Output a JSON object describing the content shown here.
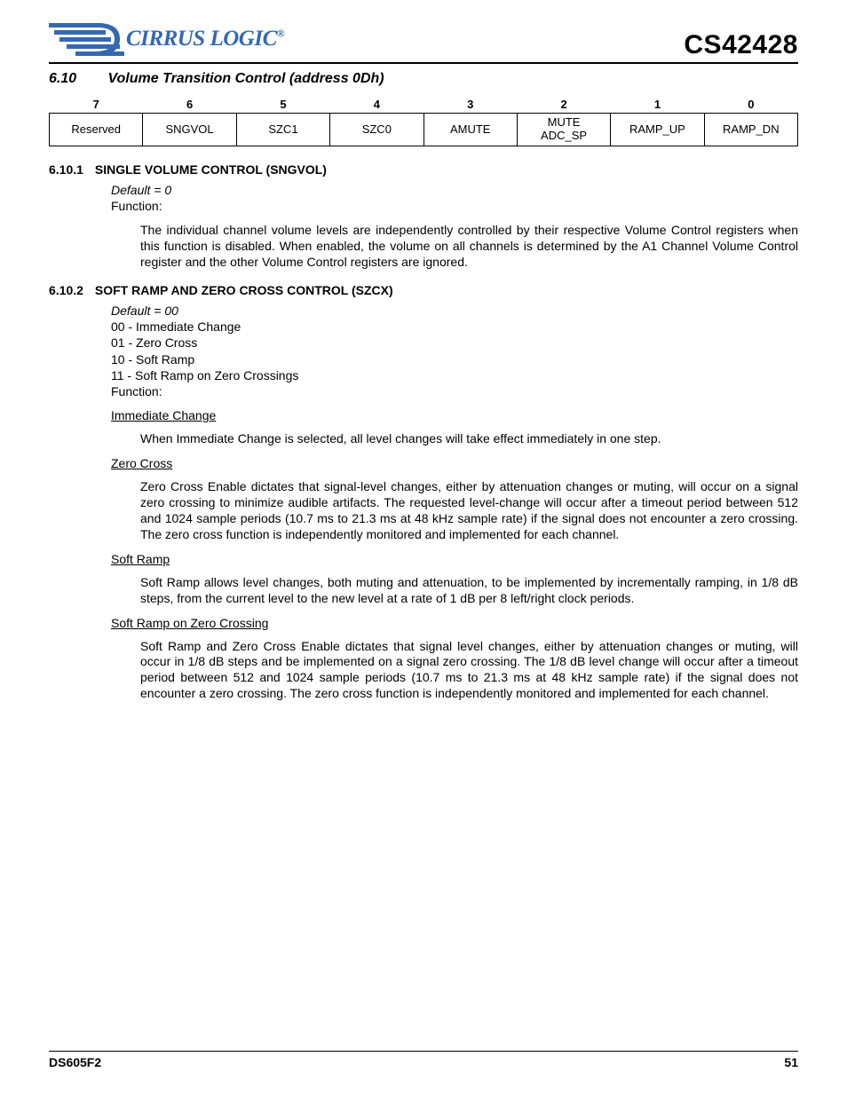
{
  "header": {
    "logo_text": "CIRRUS LOGIC",
    "part_number": "CS42428"
  },
  "section": {
    "number": "6.10",
    "title": "Volume Transition Control (address 0Dh)"
  },
  "bit_table": {
    "headers": [
      "7",
      "6",
      "5",
      "4",
      "3",
      "2",
      "1",
      "0"
    ],
    "cells": [
      "Reserved",
      "SNGVOL",
      "SZC1",
      "SZC0",
      "AMUTE",
      "MUTE ADC_SP",
      "RAMP_UP",
      "RAMP_DN"
    ]
  },
  "sub1": {
    "number": "6.10.1",
    "title": "SINGLE VOLUME CONTROL (SNGVOL)",
    "default_line": "Default = 0",
    "function_label": "Function:",
    "para": "The individual channel volume levels are independently controlled by their respective Volume Control registers when this function is disabled. When enabled, the volume on all channels is determined by the A1 Channel Volume Control register and the other Volume Control registers are ignored."
  },
  "sub2": {
    "number": "6.10.2",
    "title": "SOFT RAMP AND ZERO CROSS CONTROL (SZCX)",
    "default_line": "Default = 00",
    "opt0": "00 - Immediate Change",
    "opt1": "01 - Zero Cross",
    "opt2": "10 - Soft Ramp",
    "opt3": "11 - Soft Ramp on Zero Crossings",
    "function_label": "Function:",
    "imm_head": "Immediate Change",
    "imm_para": "When Immediate Change is selected, all level changes will take effect immediately in one step.",
    "zc_head": "Zero Cross",
    "zc_para": "Zero Cross Enable dictates that signal-level changes, either by attenuation changes or muting, will occur on a signal zero crossing to minimize audible artifacts. The requested level-change will occur after a timeout period between 512 and 1024 sample periods (10.7 ms to 21.3 ms at 48 kHz sample rate) if the signal does not encounter a zero crossing. The zero cross function is independently monitored and implemented for each channel.",
    "sr_head": "Soft Ramp",
    "sr_para": "Soft Ramp allows level changes, both muting and attenuation, to be implemented by incrementally ramping, in 1/8 dB steps, from the current level to the new level at a rate of 1 dB per 8 left/right clock periods.",
    "srzc_head": "Soft Ramp on Zero Crossing",
    "srzc_para": "Soft Ramp and Zero Cross Enable dictates that signal level changes, either by attenuation changes or muting, will occur in 1/8 dB steps and be implemented on a signal zero crossing. The 1/8 dB level change will occur after a timeout period between 512 and 1024 sample periods (10.7 ms to 21.3 ms at 48 kHz sample rate) if the signal does not encounter a zero crossing. The zero cross function is independently monitored and implemented for each channel."
  },
  "footer": {
    "left": "DS605F2",
    "right": "51"
  }
}
